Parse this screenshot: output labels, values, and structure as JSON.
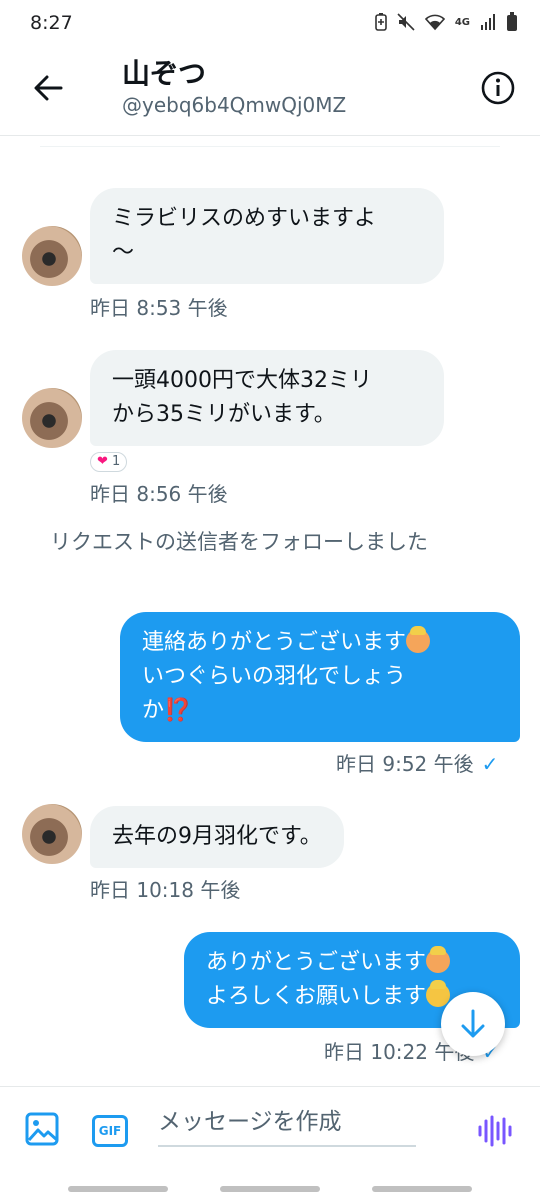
{
  "status_bar": {
    "time": "8:27",
    "network_label": "4G",
    "icons": [
      "battery-saver-icon",
      "mute-icon",
      "wifi-icon",
      "network-4g-icon",
      "signal-icon",
      "battery-icon"
    ]
  },
  "header": {
    "name": "山ぞつ",
    "handle": "@yebq6b4QmwQj0MZ",
    "back_icon": "arrow-left-icon",
    "info_icon": "info-icon"
  },
  "messages": [
    {
      "direction": "incoming",
      "text": "ミラビリスのめすいますよ\n～",
      "time": "昨日 8:53 午後"
    },
    {
      "direction": "incoming",
      "text": "一頭4000円で大体32ミリ\nから35ミリがいます。",
      "time": "昨日 8:56 午後",
      "reaction": {
        "emoji": "❤",
        "count": "1"
      }
    },
    {
      "direction": "system",
      "text": "リクエストの送信者をフォローしました"
    },
    {
      "direction": "outgoing",
      "line1": "連絡ありがとうございます",
      "line2": "いつぐらいの羽化でしょう",
      "line3": "か",
      "mark": "⁉️",
      "time": "昨日 9:52 午後"
    },
    {
      "direction": "incoming",
      "text": "去年の9月羽化です。",
      "time": "昨日 10:18 午後"
    },
    {
      "direction": "outgoing",
      "line1": "ありがとうございます",
      "line2": "よろしくお願いします",
      "time": "昨日 10:22 午後"
    }
  ],
  "colors": {
    "accent": "#1d9bf0",
    "incoming_bubble": "#eff3f4",
    "secondary_text": "#536471"
  },
  "composer": {
    "placeholder": "メッセージを作成",
    "gif_label": "GIF",
    "image_icon": "image-icon",
    "voice_icon": "voice-wave-icon"
  },
  "scroll_button_icon": "arrow-down-icon"
}
